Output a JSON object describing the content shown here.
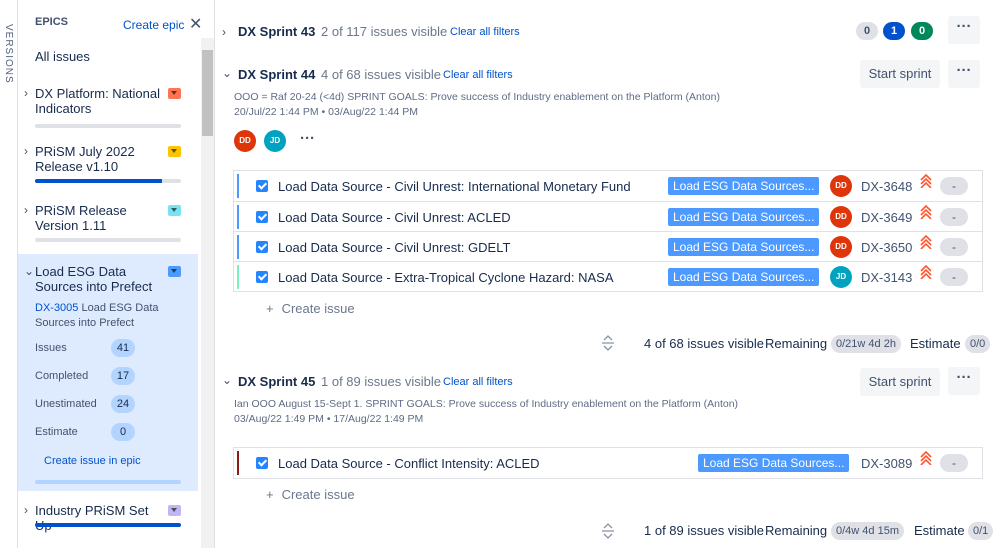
{
  "versions_tab": {
    "label": "VERSIONS"
  },
  "epics": {
    "heading": "EPICS",
    "create_epic": "Create epic",
    "close_icon": "close-icon",
    "all_issues": "All issues",
    "items": [
      {
        "name": "DX Platform: National Indicators",
        "color": "#ff7452",
        "progress": 0
      },
      {
        "name": "PRiSM July 2022 Release v1.10",
        "color": "#ffc400",
        "progress": 0.87
      },
      {
        "name": "PRiSM Release Version 1.11",
        "color": "#79e2f2",
        "progress": 0
      },
      {
        "name": "Load ESG Data Sources into Prefect",
        "color": "#4c9aff",
        "key": "DX-3005",
        "key_title": "Load ESG Data Sources into Prefect",
        "stats": [
          {
            "label": "Issues",
            "value": "41"
          },
          {
            "label": "Completed",
            "value": "17"
          },
          {
            "label": "Unestimated",
            "value": "24"
          },
          {
            "label": "Estimate",
            "value": "0"
          }
        ],
        "create_issue_in_epic": "Create issue in epic"
      },
      {
        "name": "Industry PRiSM Set Up",
        "color": "#c0b6f2",
        "progress": 1.0
      }
    ]
  },
  "sprints": [
    {
      "name": "DX Sprint 43",
      "visible": "2 of 117 issues visible",
      "clear_filters": "Clear all filters",
      "counts": [
        "0",
        "1",
        "0"
      ],
      "count_colors": [
        "#dfe1e6",
        "#0052cc",
        "#00875a"
      ]
    },
    {
      "name": "DX Sprint 44",
      "visible": "4 of 68 issues visible",
      "clear_filters": "Clear all filters",
      "start_sprint": "Start sprint",
      "goal": "OOO = Raf 20-24 (<4d) SPRINT GOALS: Prove success of Industry enablement on the Platform (Anton)",
      "dates": "20/Jul/22 1:44 PM • 03/Aug/22 1:44 PM",
      "assignees": [
        "DD",
        "JD"
      ],
      "issues": [
        {
          "summary": "Load Data Source - Civil Unrest: International Monetary Fund",
          "epic": "Load ESG Data Sources...",
          "avatar": "DD",
          "key": "DX-3648",
          "estimate": "-",
          "bar": "#4c9aff"
        },
        {
          "summary": "Load Data Source - Civil Unrest: ACLED",
          "epic": "Load ESG Data Sources...",
          "avatar": "DD",
          "key": "DX-3649",
          "estimate": "-",
          "bar": "#4c9aff"
        },
        {
          "summary": "Load Data Source - Civil Unrest: GDELT",
          "epic": "Load ESG Data Sources...",
          "avatar": "DD",
          "key": "DX-3650",
          "estimate": "-",
          "bar": "#4c9aff"
        },
        {
          "summary": "Load Data Source - Extra-Tropical Cyclone Hazard: NASA",
          "epic": "Load ESG Data Sources...",
          "avatar": "JD",
          "key": "DX-3143",
          "estimate": "-",
          "bar": "#79f2c0"
        }
      ],
      "create_issue": "Create issue",
      "footer": {
        "visible": "4 of 68 issues visible",
        "remaining_label": "Remaining",
        "remaining": "0/21w 4d 2h",
        "estimate_label": "Estimate",
        "estimate": "0/0"
      }
    },
    {
      "name": "DX Sprint 45",
      "visible": "1 of 89 issues visible",
      "clear_filters": "Clear all filters",
      "start_sprint": "Start sprint",
      "goal": "Ian OOO August 15-Sept 1. SPRINT GOALS: Prove success of Industry enablement on the Platform (Anton)",
      "dates": "03/Aug/22 1:49 PM • 17/Aug/22 1:49 PM",
      "issues": [
        {
          "summary": "Load Data Source - Conflict Intensity: ACLED",
          "epic": "Load ESG Data Sources...",
          "key": "DX-3089",
          "estimate": "-",
          "bar": "#8b1a1a"
        }
      ],
      "create_issue": "Create issue",
      "footer": {
        "visible": "1 of 89 issues visible",
        "remaining_label": "Remaining",
        "remaining": "0/4w 4d 15m",
        "estimate_label": "Estimate",
        "estimate": "0/1"
      }
    }
  ],
  "icons": {
    "priority": "highest-priority-icon",
    "more": "more-icon",
    "chevron": "chevron-icon",
    "plus": "plus-icon",
    "check": "checkbox-icon",
    "footer": "sprint-footer-icon"
  }
}
